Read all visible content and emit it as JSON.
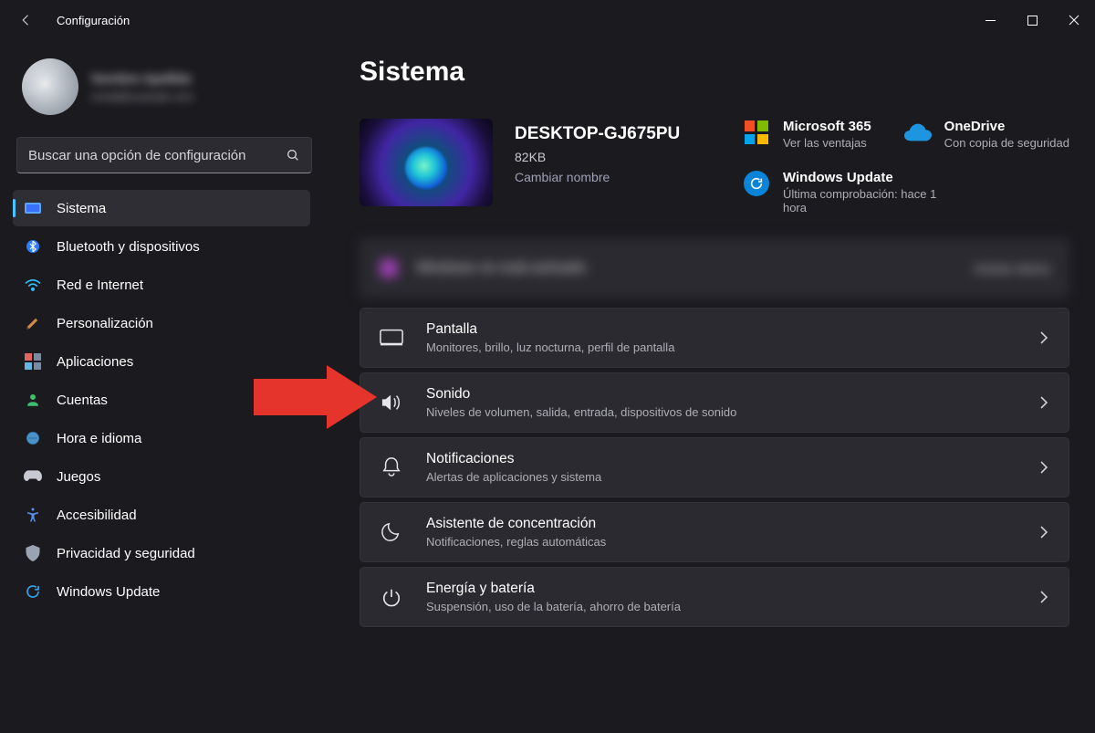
{
  "titlebar": {
    "title": "Configuración"
  },
  "profile": {
    "name": "Nombre Apellido",
    "email": "email@example.com"
  },
  "search": {
    "placeholder": "Buscar una opción de configuración"
  },
  "sidebar": {
    "items": [
      {
        "label": "Sistema",
        "icon": "monitor",
        "active": true
      },
      {
        "label": "Bluetooth y dispositivos",
        "icon": "bluetooth"
      },
      {
        "label": "Red e Internet",
        "icon": "wifi"
      },
      {
        "label": "Personalización",
        "icon": "brush"
      },
      {
        "label": "Aplicaciones",
        "icon": "apps"
      },
      {
        "label": "Cuentas",
        "icon": "user"
      },
      {
        "label": "Hora e idioma",
        "icon": "clock"
      },
      {
        "label": "Juegos",
        "icon": "gamepad"
      },
      {
        "label": "Accesibilidad",
        "icon": "accessibility"
      },
      {
        "label": "Privacidad y seguridad",
        "icon": "shield"
      },
      {
        "label": "Windows Update",
        "icon": "update"
      }
    ]
  },
  "page": {
    "title": "Sistema"
  },
  "device": {
    "name": "DESKTOP-GJ675PU",
    "sub": "82KB",
    "rename": "Cambiar nombre"
  },
  "promos": {
    "ms365": {
      "title": "Microsoft 365",
      "sub": "Ver las ventajas"
    },
    "onedrive": {
      "title": "OneDrive",
      "sub": "Con copia de seguridad"
    },
    "wu": {
      "title": "Windows Update",
      "sub": "Última comprobación: hace 1 hora"
    }
  },
  "banner": {
    "text": "Windows no está activado",
    "action": "Activar ahora"
  },
  "settings": [
    {
      "title": "Pantalla",
      "sub": "Monitores, brillo, luz nocturna, perfil de pantalla",
      "icon": "display"
    },
    {
      "title": "Sonido",
      "sub": "Niveles de volumen, salida, entrada, dispositivos de sonido",
      "icon": "sound"
    },
    {
      "title": "Notificaciones",
      "sub": "Alertas de aplicaciones y sistema",
      "icon": "bell"
    },
    {
      "title": "Asistente de concentración",
      "sub": "Notificaciones, reglas automáticas",
      "icon": "moon"
    },
    {
      "title": "Energía y batería",
      "sub": "Suspensión, uso de la batería, ahorro de batería",
      "icon": "power"
    }
  ]
}
